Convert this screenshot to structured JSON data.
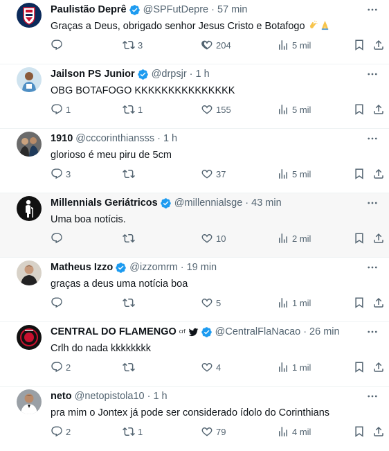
{
  "tweets": [
    {
      "name": "Paulistão Deprê",
      "verified": true,
      "handle": "@SPFutDepre",
      "time": "57 min",
      "text": "Graças a Deus, obrigado senhor Jesus Cristo e Botafogo",
      "emojis": [
        "clap-emoji",
        "praying-hands-emoji"
      ],
      "replies": "",
      "retweets": "3",
      "likes": "204",
      "views": "5 mil",
      "avatar": "paulistao-avatar",
      "hover": false
    },
    {
      "name": "Jailson PS Junior",
      "verified": true,
      "handle": "@drpsjr",
      "time": "1 h",
      "text": "OBG BOTAFOGO KKKKKKKKKKKKKKK",
      "replies": "1",
      "retweets": "1",
      "likes": "155",
      "views": "5 mil",
      "avatar": "jailson-avatar",
      "hover": false
    },
    {
      "name": "1910",
      "verified": false,
      "handle": "@cccorinthiansss",
      "time": "1 h",
      "text": "glorioso é meu piru de 5cm",
      "replies": "3",
      "retweets": "",
      "likes": "37",
      "views": "5 mil",
      "avatar": "1910-avatar",
      "hover": false
    },
    {
      "name": "Millennials Geriátricos",
      "verified": true,
      "handle": "@millennialsge",
      "time": "43 min",
      "text": "Uma boa notícis.",
      "replies": "",
      "retweets": "",
      "likes": "10",
      "views": "2 mil",
      "avatar": "millennials-avatar",
      "hover": true
    },
    {
      "name": "Matheus Izzo",
      "verified": true,
      "handle": "@izzomrm",
      "time": "19 min",
      "text": "graças a deus uma notícia boa",
      "replies": "",
      "retweets": "",
      "likes": "5",
      "views": "1 mil",
      "avatar": "matheus-avatar",
      "hover": false
    },
    {
      "name": "CENTRAL DO FLAMENGO",
      "verified": true,
      "flag": "crf",
      "bird": true,
      "handle": "@CentralFlaNacao",
      "time": "26 min",
      "text": "Crlh do nada kkkkkkkk",
      "replies": "2",
      "retweets": "",
      "likes": "4",
      "views": "1 mil",
      "avatar": "central-avatar",
      "hover": false
    },
    {
      "name": "neto",
      "verified": false,
      "handle": "@netopistola10",
      "time": "1 h",
      "text": "pra mim o Jontex já pode ser considerado ídolo do Corinthians",
      "replies": "2",
      "retweets": "1",
      "likes": "79",
      "views": "4 mil",
      "avatar": "neto-avatar",
      "hover": false
    }
  ],
  "separator": "·",
  "colors": {
    "text": "#0f1419",
    "muted": "#536471",
    "verified": "#1d9bf0",
    "hover": "#f7f7f7",
    "border": "#eff3f4"
  }
}
